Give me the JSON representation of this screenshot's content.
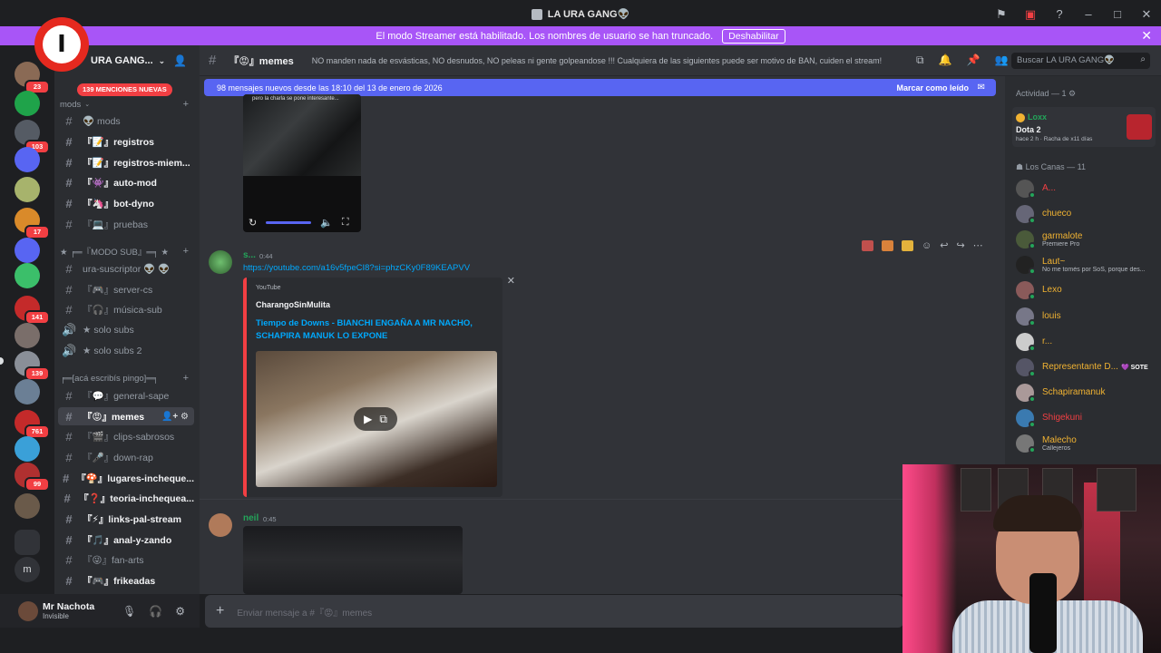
{
  "window": {
    "title": "LA URA GANG👽"
  },
  "banner": {
    "text": "El modo Streamer está habilitado. Los nombres de usuario se han truncado.",
    "button": "Deshabilitar",
    "close": "✕"
  },
  "guilds": [
    {
      "badge": "23",
      "color": "#8a6a55"
    },
    {
      "badge": "",
      "color": "#1fa34a"
    },
    {
      "badge": "103",
      "color": "#555b64"
    },
    {
      "badge": "",
      "color": "#5865f2"
    },
    {
      "badge": "",
      "color": "#a7b36c"
    },
    {
      "badge": "17",
      "color": "#d98a2a"
    },
    {
      "badge": "",
      "color": "#5865f2"
    },
    {
      "badge": "",
      "color": "#3bbf6a"
    },
    {
      "badge": "141",
      "color": "#c42a2a"
    },
    {
      "badge": "",
      "color": "#7a6e6a"
    },
    {
      "badge": "139",
      "color": "#8a8f98"
    },
    {
      "badge": "",
      "color": "#6b7f95"
    },
    {
      "badge": "761",
      "color": "#c42a2a"
    },
    {
      "badge": "",
      "color": "#3aa0d8"
    },
    {
      "badge": "99",
      "color": "#b03030"
    },
    {
      "badge": "",
      "color": "#6a5a4a"
    }
  ],
  "server": {
    "name": "URA GANG...",
    "mentions": "139 MENCIONES NUEVAS",
    "add_icon": "add-member-icon"
  },
  "categories": [
    {
      "label": "mods"
    },
    {
      "label": "★ ╒═『MODO SUB』═╕ ★"
    },
    {
      "label": "╒═[acá escribís pingo]═╕"
    }
  ],
  "channels": [
    {
      "name": "👽 mods"
    },
    {
      "name": "『📝』registros"
    },
    {
      "name": "『📝』registros-miem..."
    },
    {
      "name": "『👾』auto-mod"
    },
    {
      "name": "『🦄』bot-dyno"
    },
    {
      "name": "『💻』pruebas"
    },
    {
      "name": "ura-suscriptor 👽 👽"
    },
    {
      "name": "『🎮』server-cs"
    },
    {
      "name": "『🎧』música-sub"
    },
    {
      "name": "★ solo subs"
    },
    {
      "name": "★ solo subs 2"
    },
    {
      "name": "『💬』general-sape"
    },
    {
      "name": "『😡』memes"
    },
    {
      "name": "『🎬』clips-sabrosos"
    },
    {
      "name": "『🎤』down-rap"
    },
    {
      "name": "『🍄』lugares-incheque..."
    },
    {
      "name": "『❓』teoria-inchequea..."
    },
    {
      "name": "『⚡』links-pal-stream"
    },
    {
      "name": "『🎵』anal-y-zando"
    },
    {
      "name": "『😜』fan-arts"
    },
    {
      "name": "『🎮』frikeadas"
    }
  ],
  "user": {
    "name": "Mr Nachota",
    "status": "Invisible"
  },
  "header": {
    "channel": "『😡』memes",
    "topic": "NO manden nada de esvásticas, NO desnudos, NO peleas ni gente golpeandose !!! Cualquiera de las siguientes puede ser motivo de BAN, cuiden el stream!",
    "search_placeholder": "Buscar LA URA GANG👽"
  },
  "new_messages": {
    "text": "98 mensajes nuevos desde las 18:10 del 13 de enero de 2026",
    "action": "Marcar como leído"
  },
  "video": {
    "caption": "pero la charla se pone interesante..."
  },
  "messages": [
    {
      "author": "s...",
      "time": "0:44",
      "link": "https://youtube.com/a16v5fpeCI8?si=phzCKy0F89KEAPVV",
      "embed": {
        "provider": "YouTube",
        "author": "CharangoSinMulita",
        "title": "Tiempo de Downs - BIANCHI ENGAÑA A MR NACHO, SCHAPIRA MANUK LO EXPONE"
      }
    },
    {
      "author": "neil",
      "time": "0:45"
    }
  ],
  "composer": {
    "placeholder": "Enviar mensaje a #『😡』memes"
  },
  "members": {
    "activity_header": "Actividad — 1",
    "activity": {
      "user": "Loxx",
      "game": "Dota 2",
      "meta": "hace 2 h  ·  Racha de x11 días"
    },
    "group_header": "Los Canas — 11",
    "list": [
      {
        "name": "A...",
        "sub": "",
        "color": "#f23f43"
      },
      {
        "name": "chueco",
        "sub": "",
        "color": "#f0b232"
      },
      {
        "name": "garmalote",
        "sub": "Premiere Pro",
        "color": "#f0b232"
      },
      {
        "name": "Laut~",
        "sub": "No me tomés por SoS, porque des...",
        "color": "#f0b232"
      },
      {
        "name": "Lexo",
        "sub": "",
        "color": "#f0b232"
      },
      {
        "name": "louis",
        "sub": "",
        "color": "#f0b232"
      },
      {
        "name": "r...",
        "sub": "",
        "color": "#f0b232"
      },
      {
        "name": "Representante D...",
        "sub": "",
        "color": "#f0b232",
        "tag": "💜 SOTE"
      },
      {
        "name": "Schapiramanuk",
        "sub": "",
        "color": "#f0b232"
      },
      {
        "name": "Shigekuni",
        "sub": "",
        "color": "#f23f43"
      },
      {
        "name": "Malecho",
        "sub": "Callejeros",
        "color": "#f0b232"
      }
    ]
  },
  "overlay": {
    "logo_letter": "I"
  },
  "colors": {
    "banner": "#a855f7",
    "blurple": "#5865f2",
    "link": "#00a8fc",
    "mention": "#f23f43"
  }
}
